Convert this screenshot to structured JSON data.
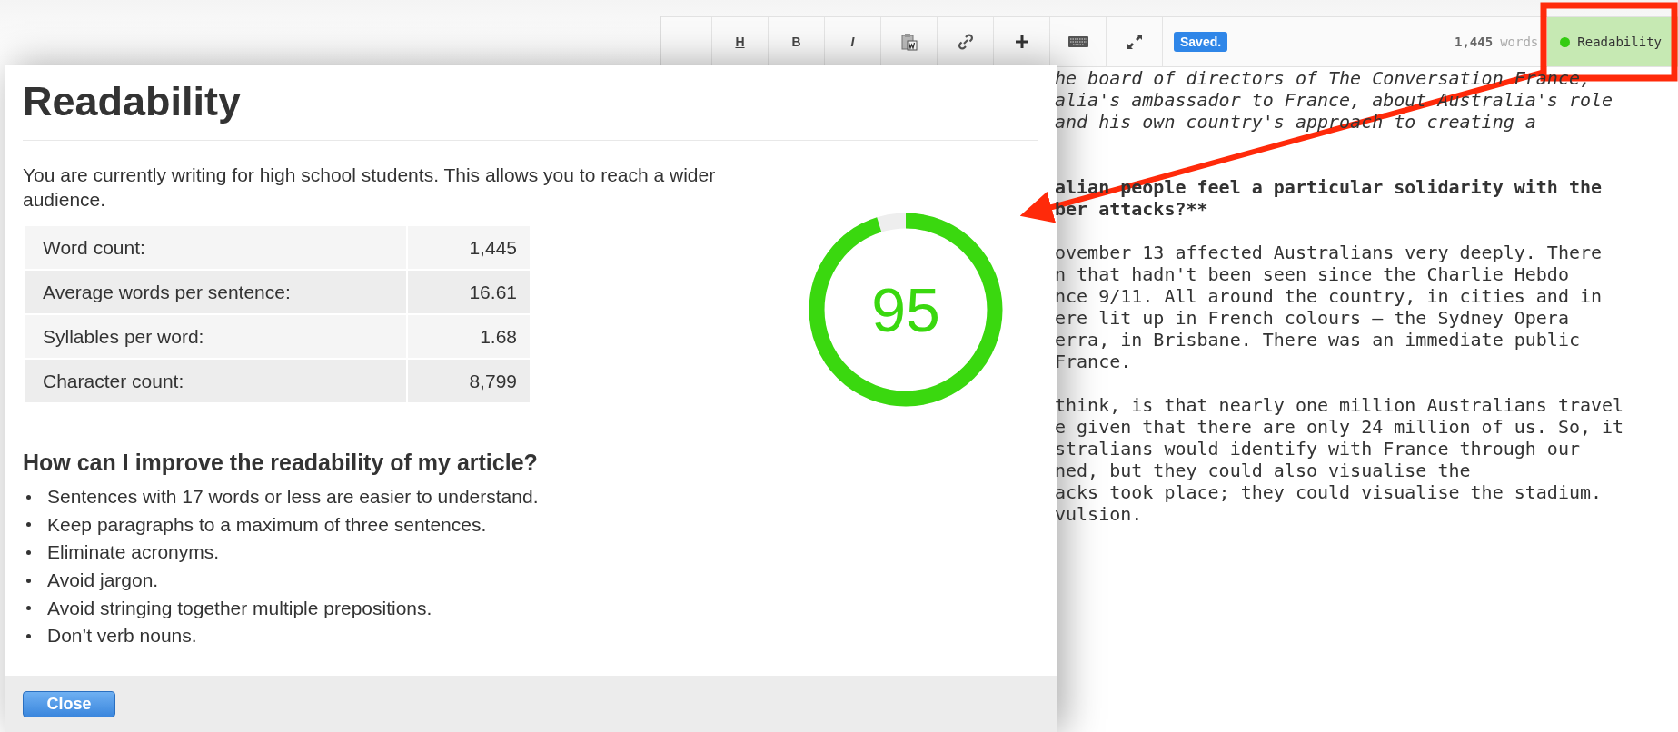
{
  "toolbar": {
    "format_buttons": [
      {
        "label": "H",
        "kind": "heading"
      },
      {
        "label": "B",
        "kind": "bold"
      },
      {
        "label": "I",
        "kind": "italic"
      }
    ],
    "save_status": "Saved.",
    "word_count": "1,445",
    "word_unit": "words",
    "readability_button": {
      "label": "Readability",
      "color": "#33cc11"
    }
  },
  "editor": {
    "paragraphs": [
      {
        "kind": "italic",
        "lines": [
          "he board of directors of The Conversation France,",
          "alia's ambassador to France, about Australia's role",
          "and his own country's approach to creating a"
        ]
      },
      {
        "kind": "bold",
        "lines": [
          "alian people feel a particular solidarity with the",
          "ber attacks?**"
        ]
      },
      {
        "kind": "plain",
        "lines": [
          "ovember 13 affected Australians very deeply. There",
          "n that hadn't been seen since the Charlie Hebdo",
          "nce 9/11. All around the country, in cities and in",
          "ere lit up in French colours – the Sydney Opera",
          "erra, in Brisbane. There was an immediate public",
          "France."
        ]
      },
      {
        "kind": "plain",
        "lines": [
          "think, is that nearly one million Australians travel",
          "e given that there are only 24 million of us. So, it",
          "stralians would identify with France through our",
          "ned, but they could also visualise the",
          "acks took place; they could visualise the stadium.",
          "vulsion."
        ]
      }
    ]
  },
  "dialog": {
    "title": "Readability",
    "intro": "You are currently writing for high school students. This allows you to reach a wider audience.",
    "stats": [
      {
        "label": "Word count:",
        "value": "1,445"
      },
      {
        "label": "Average words per sentence:",
        "value": "16.61"
      },
      {
        "label": "Syllables per word:",
        "value": "1.68"
      },
      {
        "label": "Character count:",
        "value": "8,799"
      }
    ],
    "gauge": {
      "score": "95"
    },
    "tips_heading": "How can I improve the readability of my article?",
    "tips": [
      "Sentences with 17 words or less are easier to understand.",
      "Keep paragraphs to a maximum of three sentences.",
      "Eliminate acronyms.",
      "Avoid jargon.",
      "Avoid stringing together multiple prepositions.",
      "Don’t verb nouns."
    ],
    "close_button": "Close"
  }
}
